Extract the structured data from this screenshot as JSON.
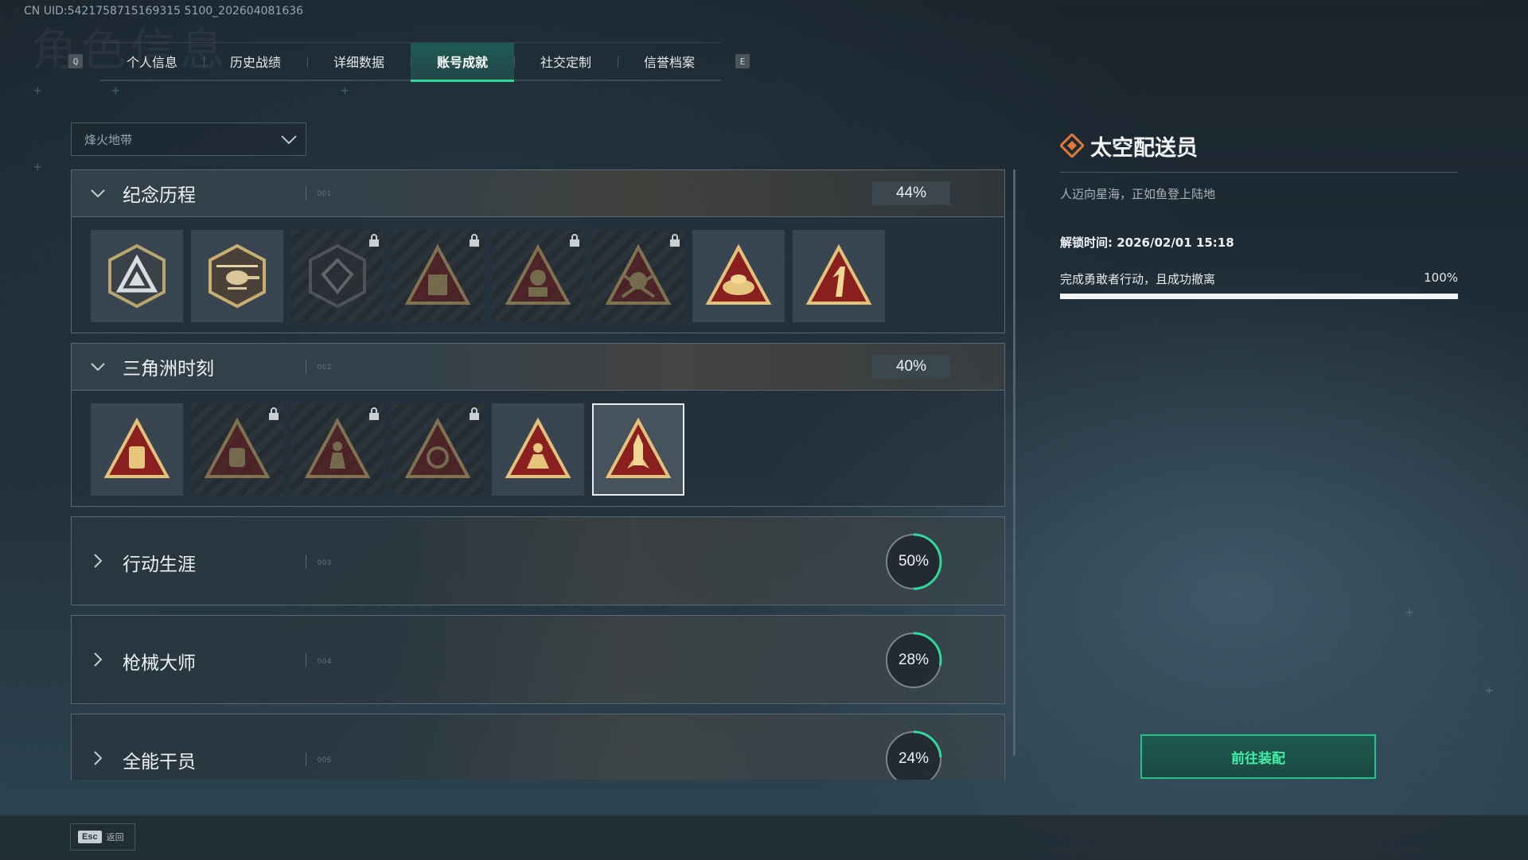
{
  "uid_text": "CN UID:5421758715169315 5100_202604081636",
  "page_bg_title": "角色信息",
  "tabs": {
    "left_key": "Q",
    "right_key": "E",
    "items": [
      {
        "label": "个人信息"
      },
      {
        "label": "历史战绩"
      },
      {
        "label": "详细数据"
      },
      {
        "label": "账号成就",
        "active": true
      },
      {
        "label": "社交定制"
      },
      {
        "label": "信誉档案"
      }
    ]
  },
  "filter": {
    "selected": "烽火地带"
  },
  "categories": [
    {
      "name": "纪念历程",
      "code": "001",
      "percent": "44%",
      "expanded": true,
      "badges": [
        {
          "icon": "delta-logo-shield-badge",
          "locked": false
        },
        {
          "icon": "helicopter-shield-badge",
          "locked": false
        },
        {
          "icon": "dark-emblem-shield-badge",
          "locked": true
        },
        {
          "icon": "sb-crate-triangle-badge",
          "locked": true
        },
        {
          "icon": "operator-triangle-badge",
          "locked": true
        },
        {
          "icon": "skull-triangle-badge",
          "locked": true
        },
        {
          "icon": "gold-mound-triangle-badge",
          "locked": false
        },
        {
          "icon": "number-one-triangle-badge",
          "locked": false
        }
      ]
    },
    {
      "name": "三角洲时刻",
      "code": "002",
      "percent": "40%",
      "expanded": true,
      "badges": [
        {
          "icon": "backpack-triangle-badge",
          "locked": false
        },
        {
          "icon": "mask-triangle-badge",
          "locked": true
        },
        {
          "icon": "runner-triangle-badge",
          "locked": true
        },
        {
          "icon": "compass-triangle-badge",
          "locked": true
        },
        {
          "icon": "squad-triangle-badge",
          "locked": false
        },
        {
          "icon": "rocket-triangle-badge",
          "locked": false,
          "selected": true
        }
      ]
    },
    {
      "name": "行动生涯",
      "code": "003",
      "percent": "50%",
      "progress": 0.5,
      "expanded": false
    },
    {
      "name": "枪械大师",
      "code": "004",
      "percent": "28%",
      "progress": 0.28,
      "expanded": false
    },
    {
      "name": "全能干员",
      "code": "005",
      "percent": "24%",
      "progress": 0.24,
      "expanded": false
    }
  ],
  "detail": {
    "title": "太空配送员",
    "description": "人迈向星海，正如鱼登上陆地",
    "unlock_time": "解锁时间: 2026/02/01 15:18",
    "requirement": "完成勇敢者行动，且成功撤离",
    "requirement_percent": "100%",
    "requirement_progress": 1.0,
    "button_label": "前往装配"
  },
  "footer": {
    "esc_key": "Esc",
    "back_label": "返回"
  },
  "colors": {
    "accent": "#30d89a",
    "badge_gold": "#d8b36a",
    "badge_red": "#8a1f1f"
  }
}
